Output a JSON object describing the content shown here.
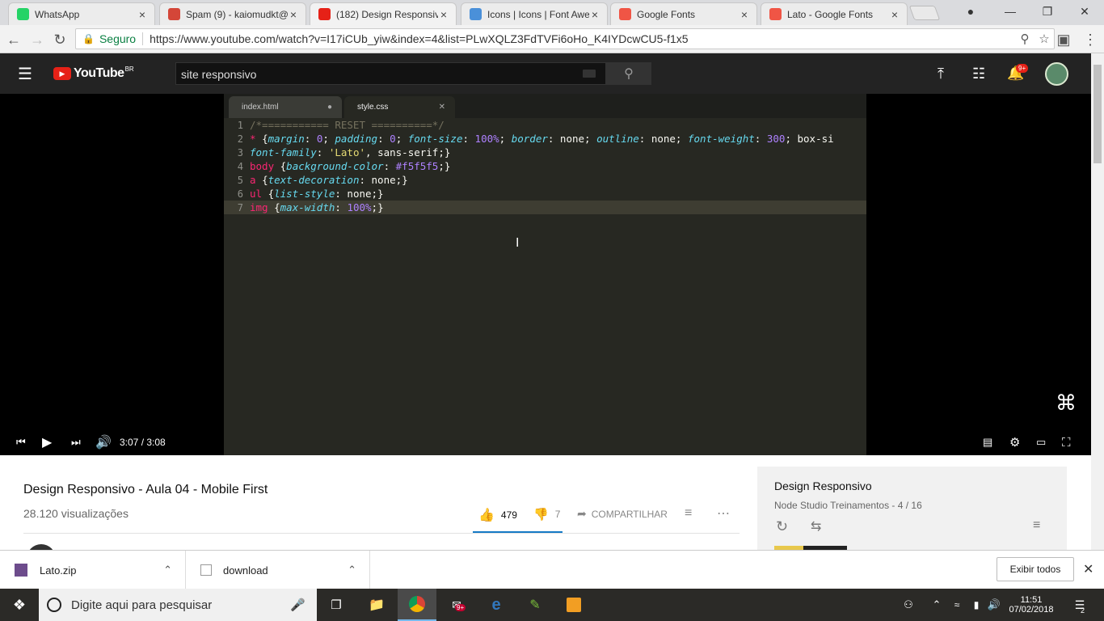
{
  "browser_tabs": [
    {
      "title": "WhatsApp",
      "icon": "whatsapp-icon",
      "color": "#25d366"
    },
    {
      "title": "Spam (9) - kaiomudkt@",
      "icon": "gmail-icon",
      "color": "#d44638"
    },
    {
      "title": "(182) Design Responsiv",
      "icon": "youtube-icon",
      "color": "#e62117",
      "active": true
    },
    {
      "title": "Icons | Icons | Font Awe",
      "icon": "flag-icon",
      "color": "#4a90d9"
    },
    {
      "title": "Google Fonts",
      "icon": "google-fonts-icon",
      "color": "#f05545"
    },
    {
      "title": "Lato - Google Fonts",
      "icon": "google-fonts-icon",
      "color": "#f05545"
    }
  ],
  "address": {
    "secure_label": "Seguro",
    "url": "https://www.youtube.com/watch?v=I17iCUb_yiw&index=4&list=PLwXQLZ3FdTVFi6oHo_K4IYDcwCU5-f1x5"
  },
  "youtube": {
    "logo": "YouTube",
    "region": "BR",
    "search_value": "site responsivo",
    "notif_badge": "9+"
  },
  "editor": {
    "tabs": [
      "index.html",
      "style.css"
    ],
    "lines": [
      {
        "n": "1",
        "parts": [
          [
            "cm",
            "/*=========== RESET ==========*/"
          ]
        ]
      },
      {
        "n": "2",
        "parts": [
          [
            "sel",
            "* "
          ],
          [
            "pl",
            "{"
          ],
          [
            "pr",
            "margin"
          ],
          [
            "pl",
            ": "
          ],
          [
            "nm",
            "0"
          ],
          [
            "pl",
            "; "
          ],
          [
            "pr",
            "padding"
          ],
          [
            "pl",
            ": "
          ],
          [
            "nm",
            "0"
          ],
          [
            "pl",
            "; "
          ],
          [
            "pr",
            "font-size"
          ],
          [
            "pl",
            ": "
          ],
          [
            "nm",
            "100%"
          ],
          [
            "pl",
            "; "
          ],
          [
            "pr",
            "border"
          ],
          [
            "pl",
            ": none; "
          ],
          [
            "pr",
            "outline"
          ],
          [
            "pl",
            ": none; "
          ],
          [
            "pr",
            "font-weight"
          ],
          [
            "pl",
            ": "
          ],
          [
            "nm",
            "300"
          ],
          [
            "pl",
            "; box-si"
          ]
        ]
      },
      {
        "n": "3",
        "parts": [
          [
            "pr",
            "font-family"
          ],
          [
            "pl",
            ": "
          ],
          [
            "st",
            "'Lato'"
          ],
          [
            "pl",
            ", sans-serif;}"
          ]
        ]
      },
      {
        "n": "4",
        "parts": [
          [
            "sel",
            "body "
          ],
          [
            "pl",
            "{"
          ],
          [
            "pr",
            "background-color"
          ],
          [
            "pl",
            ": "
          ],
          [
            "nm",
            "#f5f5f5"
          ],
          [
            "pl",
            ";}"
          ]
        ]
      },
      {
        "n": "5",
        "parts": [
          [
            "sel",
            "a "
          ],
          [
            "pl",
            "{"
          ],
          [
            "pr",
            "text-decoration"
          ],
          [
            "pl",
            ": none;}"
          ]
        ]
      },
      {
        "n": "6",
        "parts": [
          [
            "sel",
            "ul "
          ],
          [
            "pl",
            "{"
          ],
          [
            "pr",
            "list-style"
          ],
          [
            "pl",
            ": none;}"
          ]
        ]
      },
      {
        "n": "7",
        "parts": [
          [
            "sel",
            "img "
          ],
          [
            "pl",
            "{"
          ],
          [
            "pr",
            "max-width"
          ],
          [
            "pl",
            ": "
          ],
          [
            "nm",
            "100%"
          ],
          [
            "pl",
            ";}"
          ]
        ]
      }
    ]
  },
  "player": {
    "time": "3:07 / 3:08",
    "progress_fraction": 0.995
  },
  "video": {
    "title": "Design Responsivo - Aula 04 - Mobile First",
    "views": "28.120 visualizações",
    "likes": "479",
    "dislikes": "7",
    "share": "COMPARTILHAR"
  },
  "playlist": {
    "title": "Design Responsivo",
    "subtitle": "Node Studio Treinamentos - 4 / 16"
  },
  "downloads": {
    "items": [
      "Lato.zip",
      "download"
    ],
    "show_all": "Exibir todos"
  },
  "taskbar": {
    "search_placeholder": "Digite aqui para pesquisar",
    "time": "11:51",
    "date": "07/02/2018",
    "notif_count": "2",
    "mail_badge": "9+"
  }
}
